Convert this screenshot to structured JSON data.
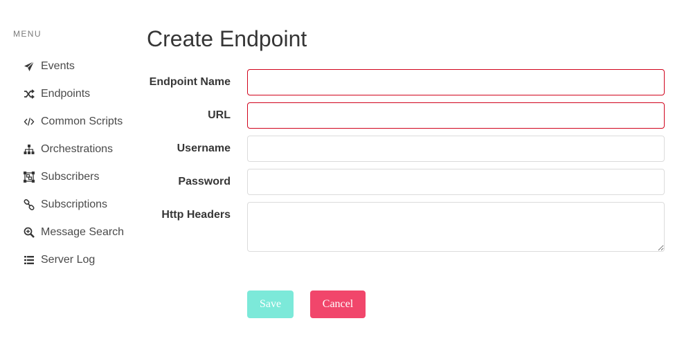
{
  "sidebar": {
    "menu_label": "MENU",
    "items": [
      {
        "label": "Events",
        "icon": "paper-plane-icon"
      },
      {
        "label": "Endpoints",
        "icon": "random-icon"
      },
      {
        "label": "Common Scripts",
        "icon": "code-icon"
      },
      {
        "label": "Orchestrations",
        "icon": "sitemap-icon"
      },
      {
        "label": "Subscribers",
        "icon": "object-group-icon"
      },
      {
        "label": "Subscriptions",
        "icon": "link-icon"
      },
      {
        "label": "Message Search",
        "icon": "search-plus-icon"
      },
      {
        "label": "Server Log",
        "icon": "list-icon"
      }
    ]
  },
  "main": {
    "title": "Create Endpoint",
    "fields": {
      "endpoint_name": {
        "label": "Endpoint Name",
        "value": ""
      },
      "url": {
        "label": "URL",
        "value": ""
      },
      "username": {
        "label": "Username",
        "value": ""
      },
      "password": {
        "label": "Password",
        "value": ""
      },
      "http_headers": {
        "label": "Http Headers",
        "value": ""
      }
    },
    "buttons": {
      "save": "Save",
      "cancel": "Cancel"
    }
  },
  "colors": {
    "invalid_border": "#d0021b",
    "save_button": "#7ce9d9",
    "cancel_button": "#f1466b"
  }
}
